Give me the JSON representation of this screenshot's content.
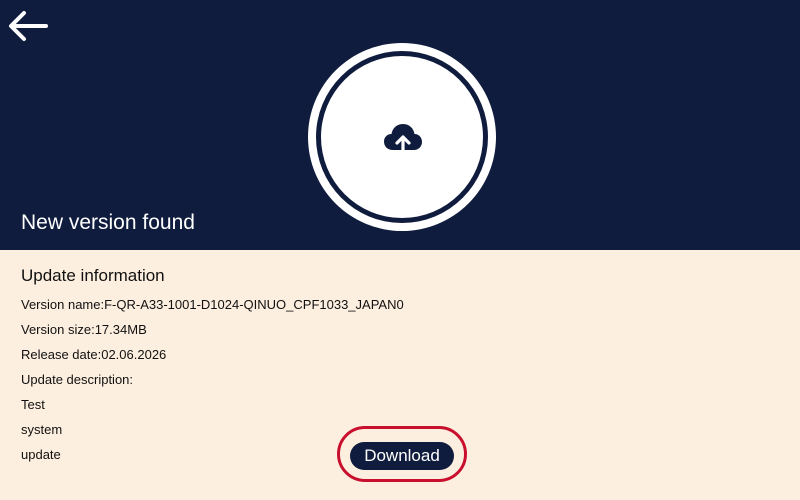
{
  "header": {
    "back_icon": "arrow-left-icon",
    "hero_icon": "cloud-upload-icon",
    "title": "New version found"
  },
  "update_info": {
    "title": "Update information",
    "version_name": "Version name:F-QR-A33-1001-D1024-QINUO_CPF1033_JAPAN0",
    "version_size": "Version size:17.34MB",
    "release_date": "Release date:02.06.2026",
    "description_label": "Update description:",
    "description_lines": [
      "Test",
      "system",
      "update"
    ]
  },
  "actions": {
    "download_label": "Download"
  },
  "colors": {
    "header_bg": "#0f1c3d",
    "content_bg": "#fdefdf",
    "button_bg": "#0f1c3d",
    "highlight_ring": "#c8102e"
  }
}
